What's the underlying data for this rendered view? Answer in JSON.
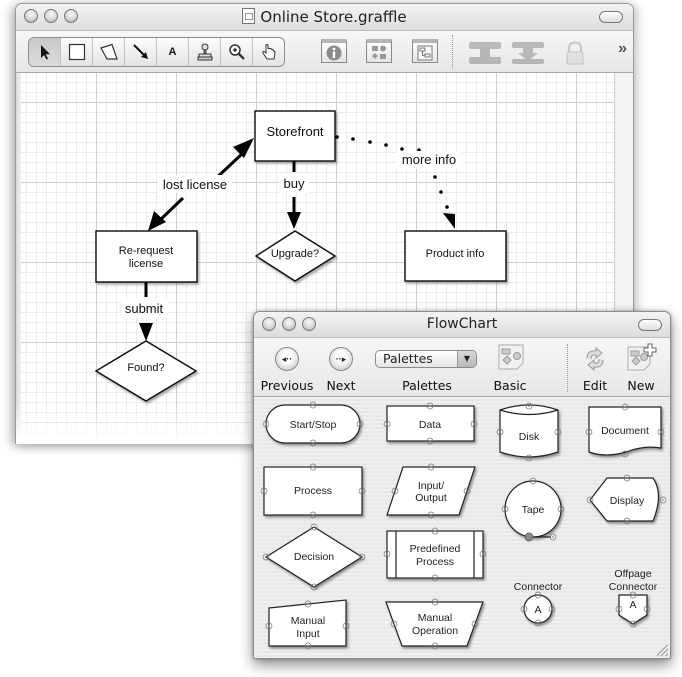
{
  "main_window": {
    "title": "Online Store.graffle",
    "toolbar": {
      "tools": [
        {
          "name": "selection-tool",
          "icon": "arrow-pointer-icon",
          "glyph": "➤",
          "selected": true
        },
        {
          "name": "shape-tool",
          "icon": "rectangle-icon",
          "glyph": "",
          "selected": false
        },
        {
          "name": "pen-tool",
          "icon": "polygon-icon",
          "glyph": "",
          "selected": false
        },
        {
          "name": "line-tool",
          "icon": "line-arrow-icon",
          "glyph": "↘",
          "selected": false
        },
        {
          "name": "text-tool",
          "icon": "text-icon",
          "glyph": "A",
          "selected": false
        },
        {
          "name": "stamp-tool",
          "icon": "stamp-icon",
          "glyph": "♙",
          "selected": false
        },
        {
          "name": "zoom-tool",
          "icon": "magnifier-icon",
          "glyph": "⊕",
          "selected": false
        },
        {
          "name": "hand-tool",
          "icon": "hand-icon",
          "glyph": "☝",
          "selected": false
        }
      ],
      "inspector_icons": [
        "info-inspector-icon",
        "stencils-icon",
        "canvases-icon"
      ],
      "disabled_icons": [
        "group-icon",
        "ungroup-icon",
        "lock-icon"
      ],
      "overflow": "»"
    },
    "diagram": {
      "nodes": [
        {
          "id": "storefront",
          "label": "Storefront",
          "shape": "rect"
        },
        {
          "id": "rerequest",
          "label_lines": [
            "Re-request",
            "license"
          ],
          "shape": "rect"
        },
        {
          "id": "upgrade",
          "label": "Upgrade?",
          "shape": "diamond"
        },
        {
          "id": "productinfo",
          "label": "Product info",
          "shape": "rect"
        },
        {
          "id": "found",
          "label": "Found?",
          "shape": "diamond"
        }
      ],
      "edges": [
        {
          "from": "rerequest",
          "to": "storefront",
          "label": "lost license",
          "style": "solid",
          "bidirectional": true
        },
        {
          "from": "storefront",
          "to": "upgrade",
          "label": "buy",
          "style": "solid"
        },
        {
          "from": "storefront",
          "to": "productinfo",
          "label": "more info",
          "style": "dotted"
        },
        {
          "from": "rerequest",
          "to": "found",
          "label": "submit",
          "style": "solid"
        }
      ]
    }
  },
  "palette_window": {
    "title": "FlowChart",
    "toolbar": {
      "previous": {
        "label": "Previous",
        "glyph": "◂··"
      },
      "next": {
        "label": "Next",
        "glyph": "··▸"
      },
      "palettes_popup": {
        "value": "Palettes",
        "label": "Palettes",
        "arrow": "▼"
      },
      "basic": {
        "label": "Basic"
      },
      "edit": {
        "label": "Edit"
      },
      "new": {
        "label": "New"
      }
    },
    "shapes": {
      "start_stop": "Start/Stop",
      "data": "Data",
      "disk": "Disk",
      "document": "Document",
      "process": "Process",
      "input_output": [
        "Input/",
        "Output"
      ],
      "tape": "Tape",
      "display": "Display",
      "decision": "Decision",
      "predefined_process": [
        "Predefined",
        "Process"
      ],
      "connector": {
        "caption": "Connector",
        "letter": "A"
      },
      "offpage_connector": {
        "caption": [
          "Offpage",
          "Connector"
        ],
        "letter": "A"
      },
      "manual_input": [
        "Manual",
        "Input"
      ],
      "manual_operation": [
        "Manual",
        "Operation"
      ]
    }
  }
}
